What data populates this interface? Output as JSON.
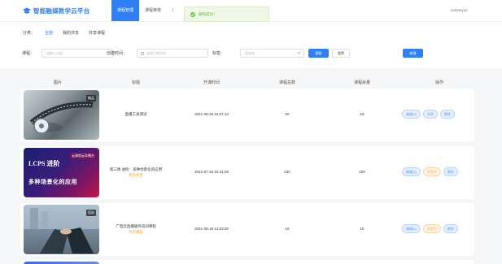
{
  "brand": {
    "title": "智能融媒教学云平台",
    "color": "#2f7ff5"
  },
  "nav": {
    "items": [
      "课程管理",
      "课程审核",
      "l"
    ],
    "active_index": 0
  },
  "user": {
    "name": "aodianyun"
  },
  "toast": {
    "message": "删除成功！"
  },
  "filter": {
    "category_label": "分类：",
    "categories": [
      "全部",
      "我的共享",
      "共享课程"
    ],
    "active_category": 0,
    "course_label": "课程：",
    "course_placeholder": "请输入内容",
    "date_label": "创建时间：",
    "date_placeholder": "选择日期时间",
    "tag_label": "标签：",
    "tag_placeholder": "请选择",
    "search_button": "搜索",
    "reset_button": "重置",
    "add_button": "新建"
  },
  "table": {
    "headers": [
      "图片",
      "标题",
      "开课时间",
      "课程总数",
      "课程余量",
      "操作"
    ],
    "rows": [
      {
        "tag": "精品",
        "title": "直播工具测试",
        "share_note": "",
        "start_time": "2021-08-25 16:07:13",
        "total": "20",
        "remain": "19",
        "ops": [
          "编辑(1)",
          "共享",
          "删除"
        ],
        "thumb_style": "thumb1"
      },
      {
        "tag": "云课程云导播台",
        "title": "第三章 进阶：多种场景化的应用",
        "share_note": "我的共享",
        "thumb_line1": "LCPS 进阶",
        "thumb_line2": "多种场景化的应用",
        "start_time": "2021-07-26 15:41:28",
        "total": "230",
        "remain": "228",
        "ops": [
          "编辑(1)",
          "共享中",
          "删除"
        ],
        "thumb_style": "thumb2"
      },
      {
        "tag": "培训",
        "title": "广电云直播服务培训课程",
        "share_note": "共享课程",
        "start_time": "2021-08-18 13:53:38",
        "total": "10",
        "remain": "10",
        "ops": [
          "编辑(0)",
          "共享中",
          "删除"
        ],
        "thumb_style": "thumb3"
      }
    ]
  }
}
